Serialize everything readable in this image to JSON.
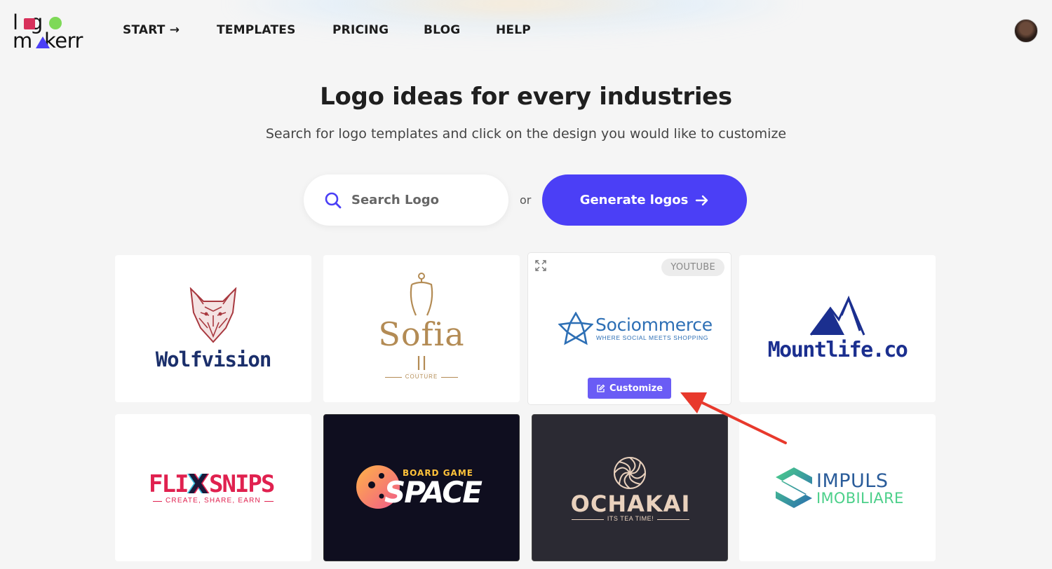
{
  "brand": {
    "line1": "logo",
    "line2": "makerr",
    "colors": {
      "square": "#d8315b",
      "dot": "#7ed957",
      "triangle": "#4b3ff6"
    }
  },
  "nav": {
    "start": "START →",
    "templates": "TEMPLATES",
    "pricing": "PRICING",
    "blog": "BLOG",
    "help": "HELP"
  },
  "hero": {
    "title": "Logo ideas for every industries",
    "subtitle": "Search for logo templates and click on the design you would like to customize"
  },
  "search": {
    "placeholder": "Search Logo",
    "value": ""
  },
  "or_text": "or",
  "generate_button": "Generate logos",
  "accent_color": "#4b3ff6",
  "cards": [
    {
      "name": "Wolfvision"
    },
    {
      "name": "Sofia",
      "tagline": "COUTURE"
    },
    {
      "name": "Sociommerce",
      "tagline": "WHERE SOCIAL MEETS SHOPPING",
      "tag": "YOUTUBE",
      "customize": "Customize"
    },
    {
      "name": "Mountlife.co"
    },
    {
      "name_left": "FLI",
      "name_mid": "X",
      "name_right": "SNIPS",
      "tagline": "CREATE, SHARE, EARN"
    },
    {
      "name_top": "BOARD GAME",
      "name": "SPACE"
    },
    {
      "name": "OCHAKAI",
      "tagline": "ITS TEA TIME!"
    },
    {
      "name_top": "IMPULS",
      "name_bottom": "IMOBILIARE"
    }
  ]
}
